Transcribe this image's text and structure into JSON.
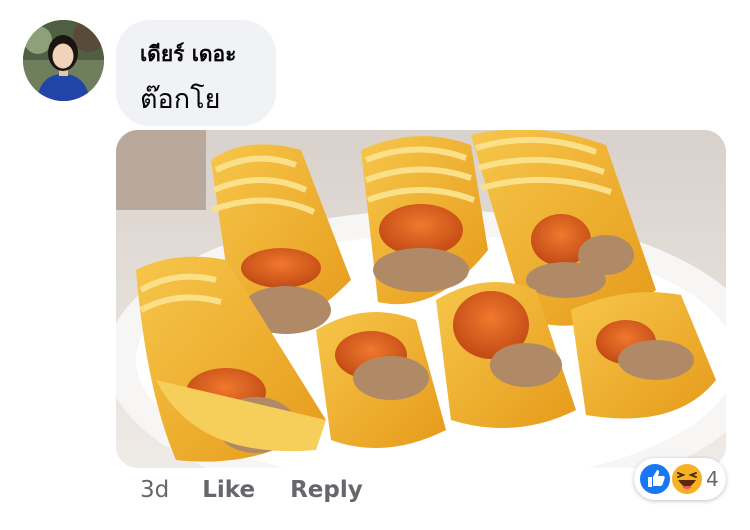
{
  "comment": {
    "author_name": "เดียร์ เดอะ",
    "text": "ต๊อกโย",
    "image_description": "food-photo-rolled-egg-crepes-with-sausage",
    "meta": {
      "time": "3d",
      "like_label": "Like",
      "reply_label": "Reply"
    },
    "reactions": {
      "icons": [
        "like-icon",
        "haha-icon"
      ],
      "count": "4"
    }
  },
  "colors": {
    "bubble_bg": "#f0f2f5",
    "meta_text": "#65676b",
    "like_blue": "#1877f2",
    "haha_yellow": "#f7b125"
  }
}
